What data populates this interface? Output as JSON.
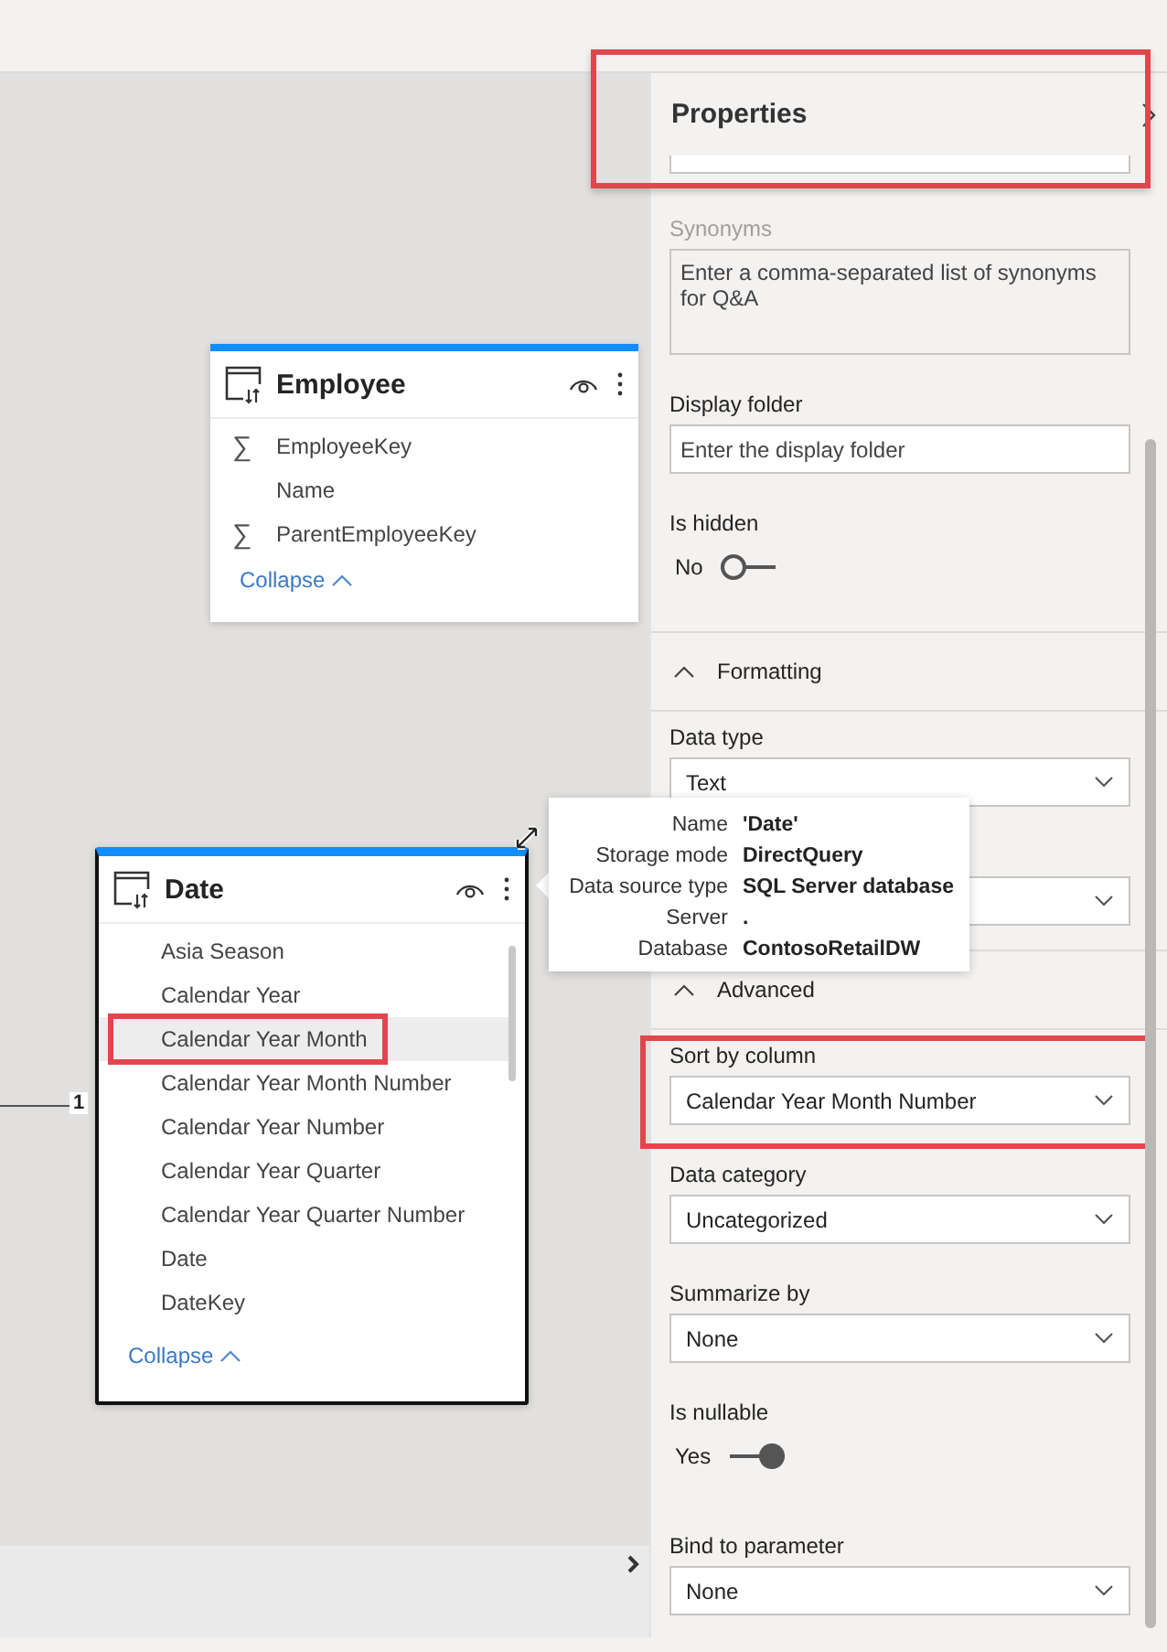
{
  "canvas": {
    "tables": [
      {
        "title": "Employee",
        "focused": false,
        "columns": [
          {
            "name": "EmployeeKey",
            "kind": "sum",
            "symbol": "∑",
            "selected": false,
            "highlighted": false
          },
          {
            "name": "Name",
            "kind": "text",
            "selected": false,
            "highlighted": false
          },
          {
            "name": "ParentEmployeeKey",
            "kind": "sum",
            "symbol": "∑",
            "selected": false,
            "highlighted": false
          }
        ],
        "collapse": "Collapse"
      },
      {
        "title": "Date",
        "focused": true,
        "columns": [
          {
            "name": "Asia Season",
            "kind": "text",
            "selected": false,
            "highlighted": false
          },
          {
            "name": "Calendar Year",
            "kind": "text",
            "selected": false,
            "highlighted": false
          },
          {
            "name": "Calendar Year Month",
            "kind": "text",
            "selected": true,
            "highlighted": true
          },
          {
            "name": "Calendar Year Month Number",
            "kind": "text",
            "selected": false,
            "highlighted": false
          },
          {
            "name": "Calendar Year Number",
            "kind": "text",
            "selected": false,
            "highlighted": false
          },
          {
            "name": "Calendar Year Quarter",
            "kind": "text",
            "selected": false,
            "highlighted": false
          },
          {
            "name": "Calendar Year Quarter Number",
            "kind": "text",
            "selected": false,
            "highlighted": false
          },
          {
            "name": "Date",
            "kind": "text",
            "selected": false,
            "highlighted": false
          },
          {
            "name": "DateKey",
            "kind": "text",
            "selected": false,
            "highlighted": false
          }
        ],
        "collapse": "Collapse"
      }
    ],
    "relationship": {
      "label": "1"
    },
    "tooltip": {
      "rows": [
        {
          "key": "Name",
          "value": "'Date'"
        },
        {
          "key": "Storage mode",
          "value": "DirectQuery"
        },
        {
          "key": "Data source type",
          "value": "SQL Server database"
        },
        {
          "key": "Server",
          "value": "."
        },
        {
          "key": "Database",
          "value": "ContosoRetailDW"
        }
      ]
    }
  },
  "properties": {
    "title": "Properties",
    "highlighted": true,
    "items": [
      {
        "kind": "stub"
      },
      {
        "kind": "textarea",
        "label": "Synonyms",
        "disabled": true,
        "placeholder": "Enter a comma-separated list of synonyms for Q&A"
      },
      {
        "kind": "input",
        "label": "Display folder",
        "placeholder": "Enter the display folder"
      },
      {
        "kind": "toggle",
        "label": "Is hidden",
        "state_text": "No",
        "on": false
      },
      {
        "kind": "section",
        "label": "Formatting",
        "expanded": true
      },
      {
        "kind": "dropdown",
        "label": "Data type",
        "value": "Text",
        "highlighted": false
      },
      {
        "kind": "dropdown",
        "highlighted": false
      },
      {
        "kind": "section",
        "label": "Advanced",
        "expanded": true
      },
      {
        "kind": "dropdown",
        "label": "Sort by column",
        "value": "Calendar Year Month Number",
        "highlighted": true
      },
      {
        "kind": "dropdown",
        "label": "Data category",
        "value": "Uncategorized",
        "highlighted": false
      },
      {
        "kind": "dropdown",
        "label": "Summarize by",
        "value": "None",
        "highlighted": false
      },
      {
        "kind": "toggle",
        "label": "Is nullable",
        "state_text": "Yes",
        "on": true
      },
      {
        "kind": "dropdown",
        "label": "Bind to parameter",
        "value": "None",
        "highlighted": false
      }
    ]
  }
}
